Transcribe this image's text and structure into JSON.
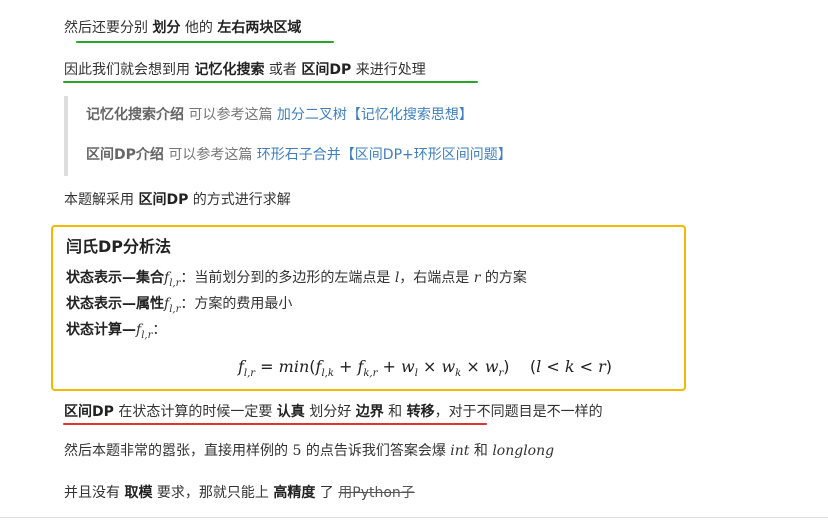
{
  "line1": {
    "a": "然后还要分别 ",
    "b1": "划分",
    "c": " 他的 ",
    "b2": "左右两块区域"
  },
  "line2": {
    "a": "因此我们就会想到用 ",
    "b1": "记忆化搜索",
    "c": " 或者 ",
    "b2": "区间DP",
    "d": " 来进行处理"
  },
  "quote": {
    "q1": {
      "bold": "记忆化搜索介绍",
      "text": " 可以参考这篇 ",
      "link": "加分二叉树【记忆化搜索思想】"
    },
    "q2": {
      "bold": "区间DP介绍",
      "text": " 可以参考这篇 ",
      "link": "环形石子合并【区间DP+环形区间问题】"
    }
  },
  "line3": {
    "a": "本题解采用 ",
    "b": "区间DP",
    "c": " 的方式进行求解"
  },
  "box": {
    "title": "闫氏DP分析法",
    "l1": {
      "bold": "状态表示—集合",
      "text": "：当前划分到的多边形的左端点是 ",
      "v1": "l",
      "mid": "，右端点是 ",
      "v2": "r",
      "end": " 的方案"
    },
    "l2": {
      "bold": "状态表示—属性",
      "text": "：方案的费用最小"
    },
    "l3": {
      "bold": "状态计算—",
      "text": "："
    },
    "formula": "f_{l,r} = min(f_{l,k} + f_{k,r} + w_l × w_k × w_r)   (l < k < r)"
  },
  "line4": {
    "b1": "区间DP",
    "a": " 在状态计算的时候一定要 ",
    "b2": "认真",
    "c": " 划分好 ",
    "b3": "边界",
    "d": " 和 ",
    "b4": "转移",
    "e": "，对于不同题目是不一样的"
  },
  "line5": {
    "a": "然后本题非常的嚣张，直接用样例的 ",
    "n": "5",
    "b": " 的点告诉我们答案会爆 ",
    "m1": "int",
    "c": " 和 ",
    "m2": "longlong"
  },
  "line6": {
    "a": "并且没有 ",
    "b1": "取模",
    "c": " 要求，那就只能上 ",
    "b2": "高精度",
    "d": " 了 ",
    "s": "用Python子"
  },
  "colors": {
    "green": "#2aa52a",
    "red": "#e0322e",
    "yellow": "#f5b800",
    "link": "#3f7fbf"
  }
}
